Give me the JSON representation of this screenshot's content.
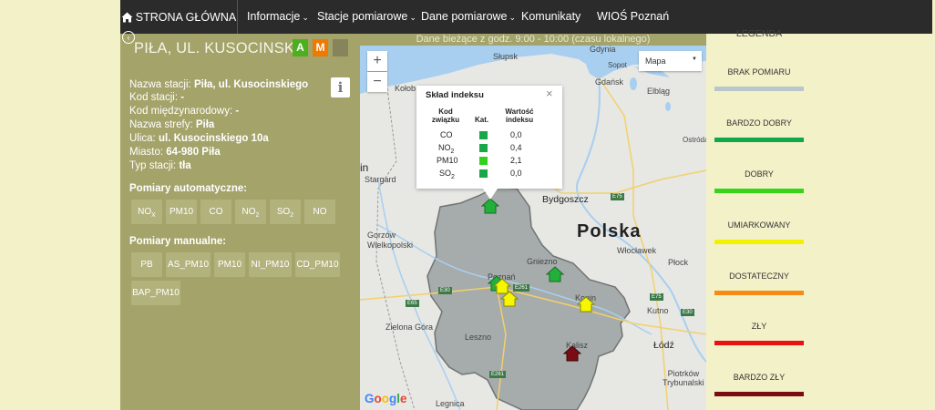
{
  "nav": {
    "home": "STRONA GŁÓWNA",
    "items": [
      "Informacje",
      "Stacje pomiarowe",
      "Dane pomiarowe",
      "Komunikaty",
      "WIOŚ Poznań"
    ]
  },
  "station": {
    "title": "PIŁA, UL. KUSOCINSK...",
    "badge_a": "A",
    "badge_m": "M",
    "info": {
      "name_label": "Nazwa stacji:",
      "name_value": "Piła, ul. Kusocinskiego",
      "code_label": "Kod stacji:",
      "code_value": "-",
      "intl_label": "Kod międzynarodowy:",
      "intl_value": "-",
      "zone_label": "Nazwa strefy:",
      "zone_value": "Piła",
      "street_label": "Ulica:",
      "street_value": "ul. Kusocinskiego 10a",
      "city_label": "Miasto:",
      "city_value": "64-980 Piła",
      "type_label": "Typ stacji:",
      "type_value": "tła"
    },
    "auto_title": "Pomiary automatyczne:",
    "auto_buttons": [
      "NO",
      "PM10",
      "CO",
      "NO",
      "SO",
      "NO"
    ],
    "manual_title": "Pomiary manualne:",
    "manual_buttons": [
      "PB",
      "AS_PM10",
      "PM10",
      "NI_PM10",
      "CD_PM10",
      "BAP_PM10"
    ]
  },
  "map": {
    "header": "Dane bieżące z godz. 9:00 - 10:00 (czasu lokalnego)",
    "zoom_in": "+",
    "zoom_out": "−",
    "type_label": "Mapa",
    "google": [
      "G",
      "o",
      "o",
      "g",
      "l",
      "e"
    ],
    "labels": {
      "gdynia": "Gdynia",
      "slupsk": "Słupsk",
      "sopot": "Sopot",
      "gdansk": "Gdańsk",
      "elblag": "Elbląg",
      "kolobrzeg": "Kołob",
      "ostroda": "Ostróda",
      "stargard": "Stargard",
      "bydgoszcz": "Bydgoszcz",
      "polska": "Polska",
      "gorzow": "Gorzów\nWielkopolski",
      "wloclawek": "Włocławek",
      "gniezno": "Gniezno",
      "poznan": "Poznań",
      "plock": "Płock",
      "konin": "Konin",
      "kutno": "Kutno",
      "zielona": "Zielona Góra",
      "leszno": "Leszno",
      "kalisz": "Kalisz",
      "lodz": "Łódź",
      "piotrkow": "Piotrków\nTrybunalski",
      "legnica": "Legnica",
      "in": "in"
    },
    "roads": [
      "E75",
      "E30",
      "E261",
      "E65",
      "E30",
      "E261",
      "E75"
    ],
    "popup": {
      "title": "Skład indeksu",
      "close": "×",
      "col_code": "Kod\nzwiązku",
      "col_cat": "Kat.",
      "col_value": "Wartość\nindeksu",
      "rows": [
        {
          "code": "CO",
          "sub": "",
          "value": "0,0",
          "color": "#18a84a"
        },
        {
          "code": "NO",
          "sub": "2",
          "value": "0,4",
          "color": "#18a84a"
        },
        {
          "code": "PM10",
          "sub": "",
          "value": "2,1",
          "color": "#33d11c"
        },
        {
          "code": "SO",
          "sub": "2",
          "value": "0,0",
          "color": "#18a84a"
        }
      ]
    }
  },
  "legend": {
    "title": "LEGENDA",
    "items": [
      {
        "label": "BRAK POMIARU",
        "color": "#b9c7cc"
      },
      {
        "label": "BARDZO DOBRY",
        "color": "#0fa84a"
      },
      {
        "label": "DOBRY",
        "color": "#38d41a"
      },
      {
        "label": "UMIARKOWANY",
        "color": "#f2f200"
      },
      {
        "label": "DOSTATECZNY",
        "color": "#f58a14"
      },
      {
        "label": "ZŁY",
        "color": "#e81212"
      },
      {
        "label": "BARDZO ZŁY",
        "color": "#7a0c14"
      }
    ]
  }
}
